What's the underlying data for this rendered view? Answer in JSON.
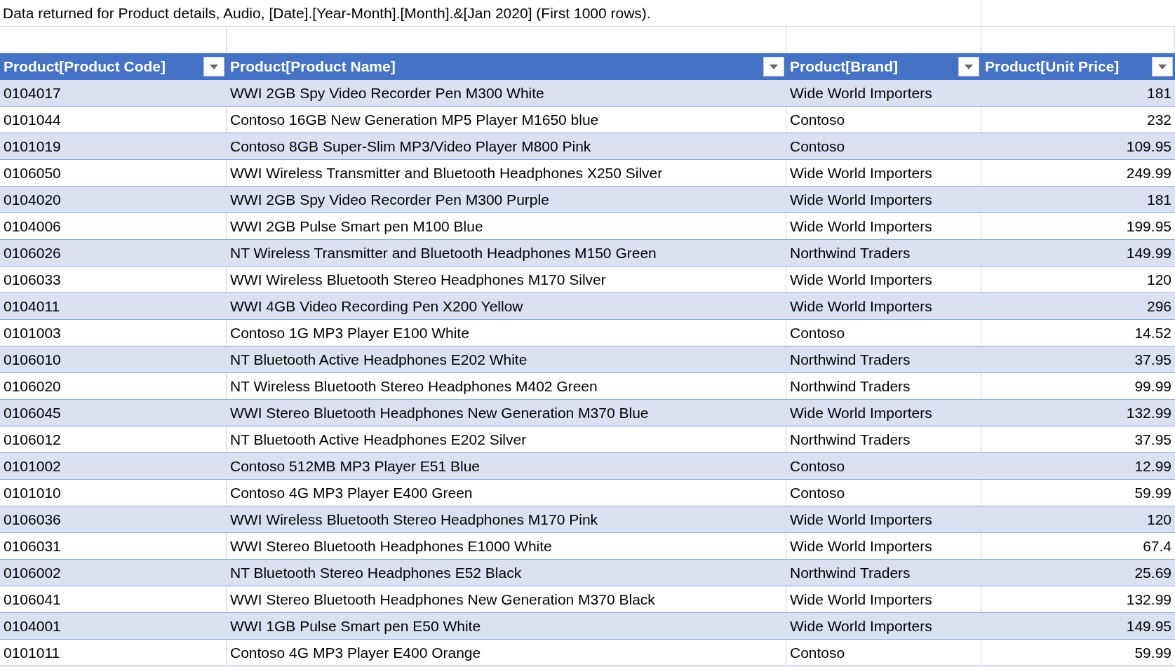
{
  "caption": "Data returned for Product details, Audio, [Date].[Year-Month].[Month].&[Jan 2020] (First 1000 rows).",
  "table": {
    "columns": [
      {
        "label": "Product[Product Code]",
        "kind": "text"
      },
      {
        "label": "Product[Product Name]",
        "kind": "text"
      },
      {
        "label": "Product[Brand]",
        "kind": "text"
      },
      {
        "label": "Product[Unit Price]",
        "kind": "number"
      }
    ],
    "rows": [
      [
        "0104017",
        "WWI 2GB Spy Video Recorder Pen M300 White",
        "Wide World Importers",
        "181"
      ],
      [
        "0101044",
        "Contoso 16GB New Generation MP5 Player M1650 blue",
        "Contoso",
        "232"
      ],
      [
        "0101019",
        "Contoso 8GB Super-Slim MP3/Video Player M800 Pink",
        "Contoso",
        "109.95"
      ],
      [
        "0106050",
        "WWI Wireless Transmitter and Bluetooth Headphones X250 Silver",
        "Wide World Importers",
        "249.99"
      ],
      [
        "0104020",
        "WWI 2GB Spy Video Recorder Pen M300 Purple",
        "Wide World Importers",
        "181"
      ],
      [
        "0104006",
        "WWI 2GB Pulse Smart pen M100 Blue",
        "Wide World Importers",
        "199.95"
      ],
      [
        "0106026",
        "NT Wireless Transmitter and Bluetooth Headphones M150 Green",
        "Northwind Traders",
        "149.99"
      ],
      [
        "0106033",
        "WWI Wireless Bluetooth Stereo Headphones M170 Silver",
        "Wide World Importers",
        "120"
      ],
      [
        "0104011",
        "WWI 4GB Video Recording Pen X200 Yellow",
        "Wide World Importers",
        "296"
      ],
      [
        "0101003",
        "Contoso 1G MP3 Player E100 White",
        "Contoso",
        "14.52"
      ],
      [
        "0106010",
        "NT Bluetooth Active Headphones E202 White",
        "Northwind Traders",
        "37.95"
      ],
      [
        "0106020",
        "NT Wireless Bluetooth Stereo Headphones M402 Green",
        "Northwind Traders",
        "99.99"
      ],
      [
        "0106045",
        "WWI Stereo Bluetooth Headphones New Generation M370 Blue",
        "Wide World Importers",
        "132.99"
      ],
      [
        "0106012",
        "NT Bluetooth Active Headphones E202 Silver",
        "Northwind Traders",
        "37.95"
      ],
      [
        "0101002",
        "Contoso 512MB MP3 Player E51 Blue",
        "Contoso",
        "12.99"
      ],
      [
        "0101010",
        "Contoso 4G MP3 Player E400 Green",
        "Contoso",
        "59.99"
      ],
      [
        "0106036",
        "WWI Wireless Bluetooth Stereo Headphones M170 Pink",
        "Wide World Importers",
        "120"
      ],
      [
        "0106031",
        "WWI Stereo Bluetooth Headphones E1000 White",
        "Wide World Importers",
        "67.4"
      ],
      [
        "0106002",
        "NT Bluetooth Stereo Headphones E52 Black",
        "Northwind Traders",
        "25.69"
      ],
      [
        "0106041",
        "WWI Stereo Bluetooth Headphones New Generation M370 Black",
        "Wide World Importers",
        "132.99"
      ],
      [
        "0104001",
        "WWI 1GB Pulse Smart pen E50 White",
        "Wide World Importers",
        "149.95"
      ],
      [
        "0101011",
        "Contoso 4G MP3 Player E400 Orange",
        "Contoso",
        "59.99"
      ]
    ]
  }
}
